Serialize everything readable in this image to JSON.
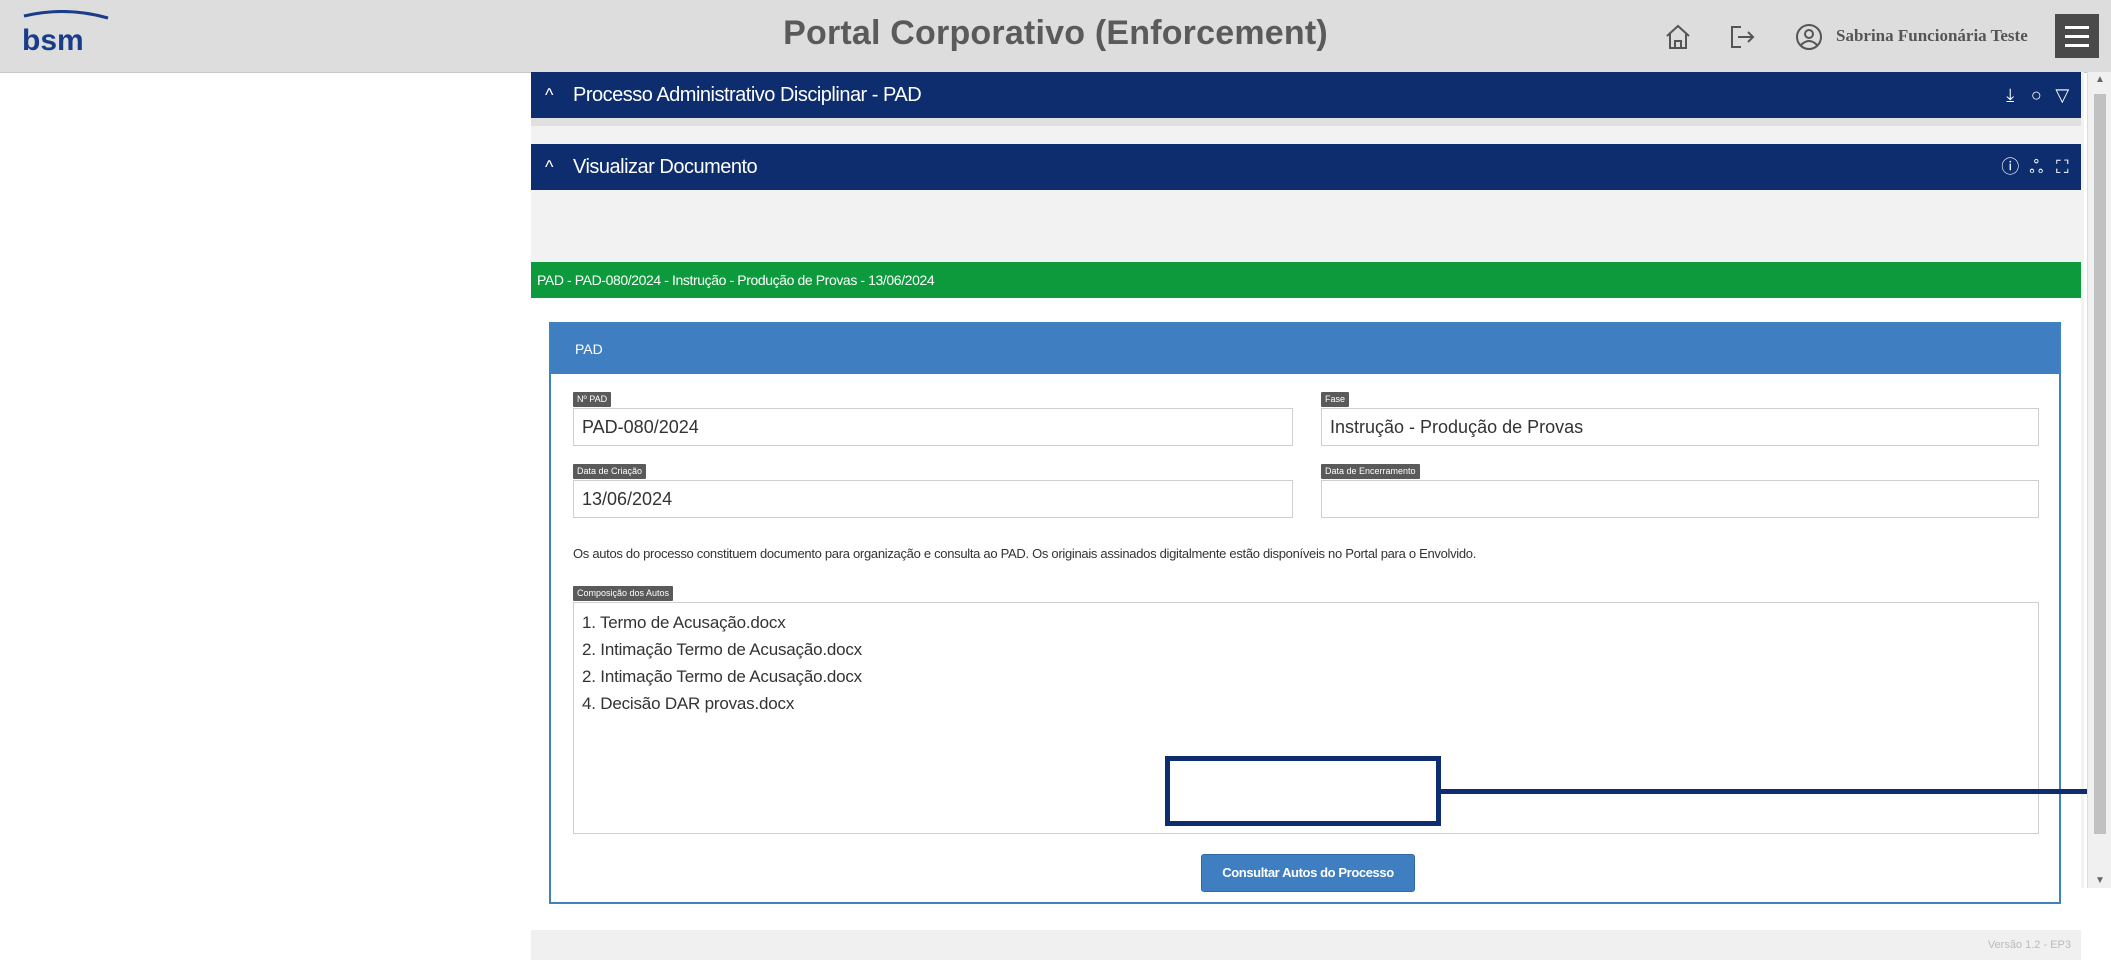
{
  "header": {
    "logo_text": "bsm",
    "title": "Portal Corporativo (Enforcement)",
    "icons": [
      "home-icon",
      "logout-icon",
      "user-icon",
      "menu-icon"
    ],
    "user_name": "Sabrina Funcionária Teste"
  },
  "panels": {
    "pad_panel": {
      "title": "Processo Administrativo Disciplinar - PAD",
      "actions": [
        "download-icon",
        "refresh-icon",
        "filter-icon"
      ]
    },
    "document_panel": {
      "title": "Visualizar Documento",
      "actions": [
        "info-icon",
        "share-icon",
        "fullscreen-icon"
      ]
    }
  },
  "document": {
    "strip_text": "PAD - PAD-080/2024 - Instrução - Produção de Provas - 13/06/2024",
    "card_title": "PAD",
    "fields": {
      "num_pad": {
        "label": "Nº PAD",
        "value": "PAD-080/2024"
      },
      "fase": {
        "label": "Fase",
        "value": "Instrução - Produção de Provas"
      },
      "data_criacao": {
        "label": "Data de Criação",
        "value": "13/06/2024"
      },
      "data_encerramento": {
        "label": "Data de Encerramento",
        "value": ""
      }
    },
    "info_text": "Os autos do processo constituem documento para organização e consulta ao PAD. Os originais assinados digitalmente estão disponíveis no Portal para o Envolvido.",
    "composicao": {
      "label": "Composição dos Autos",
      "items": [
        "1. Termo de Acusação.docx",
        "2. Intimação Termo de Acusação.docx",
        "2. Intimação Termo de Acusação.docx",
        "4. Decisão DAR provas.docx"
      ]
    },
    "consult_button": "Consultar Autos do Processo"
  },
  "footer": {
    "version": "Versão 1.2 - EP3"
  },
  "colors": {
    "header_bg": "#dddddd",
    "panel_navy": "#0d2d6e",
    "strip_green": "#0c9a3c",
    "card_blue": "#3f7fc1",
    "highlight": "#0d2d6e"
  }
}
